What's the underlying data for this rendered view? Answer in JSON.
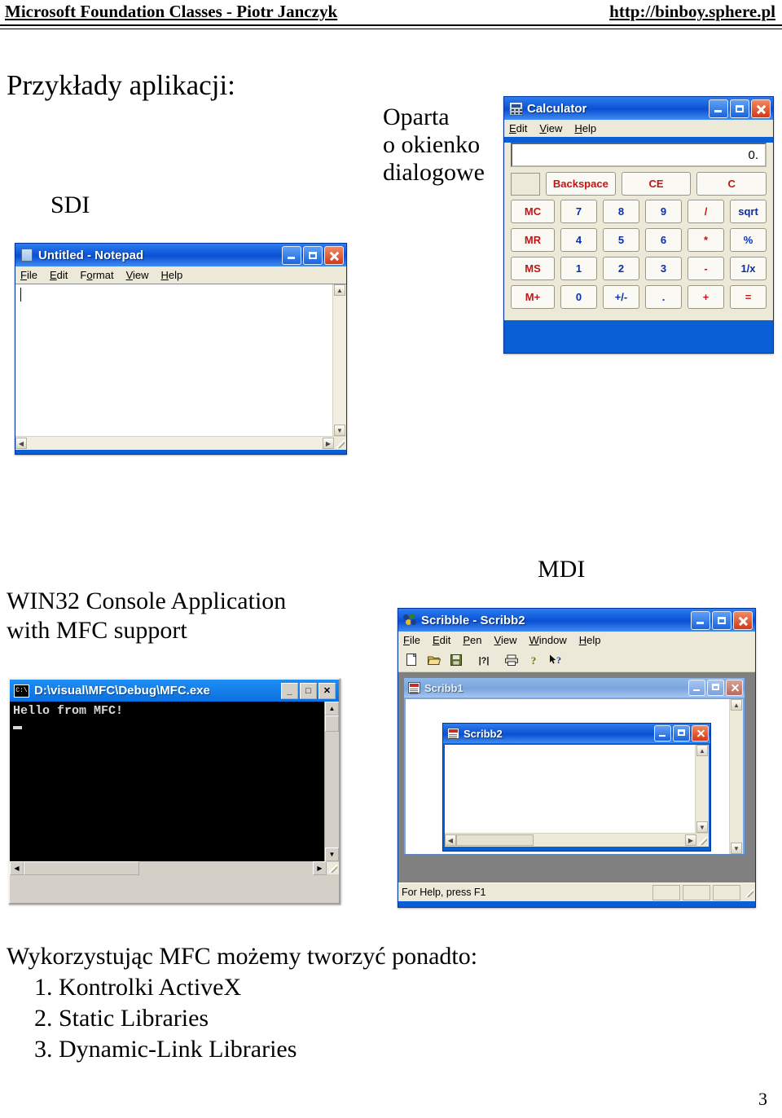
{
  "header": {
    "left": "Microsoft Foundation Classes - Piotr Janczyk",
    "right": "http://binboy.sphere.pl"
  },
  "slide": {
    "title": "Przykłady aplikacji:",
    "label_sdi": "SDI",
    "label_mdi": "MDI",
    "label_dialog_line1": "Oparta",
    "label_dialog_line2": "o okienko",
    "label_dialog_line3": "dialogowe",
    "label_console_line1": "WIN32 Console Application",
    "label_console_line2": "with MFC support",
    "footer_intro": "Wykorzystując MFC możemy tworzyć ponadto:",
    "footer_items": [
      "1. Kontrolki ActiveX",
      "2. Static Libraries",
      "3. Dynamic-Link Libraries"
    ],
    "page_number": "3"
  },
  "notepad": {
    "title": "Untitled - Notepad",
    "icon": "notepad-icon",
    "menu": [
      {
        "accel": "F",
        "rest": "ile"
      },
      {
        "accel": "E",
        "rest": "dit"
      },
      {
        "pre": "F",
        "accel": "o",
        "rest": "rmat"
      },
      {
        "accel": "V",
        "rest": "iew"
      },
      {
        "accel": "H",
        "rest": "elp"
      }
    ],
    "text": "",
    "buttons": {
      "minimize": "minimize",
      "maximize": "maximize",
      "close": "close"
    }
  },
  "calculator": {
    "title": "Calculator",
    "icon": "calculator-icon",
    "menu": [
      {
        "accel": "E",
        "rest": "dit"
      },
      {
        "accel": "V",
        "rest": "iew"
      },
      {
        "accel": "H",
        "rest": "elp"
      }
    ],
    "display": "0.",
    "memory_indicator": "",
    "top_row": [
      "Backspace",
      "CE",
      "C"
    ],
    "rows": [
      {
        "mem": "MC",
        "keys": [
          "7",
          "8",
          "9",
          "/",
          "sqrt"
        ]
      },
      {
        "mem": "MR",
        "keys": [
          "4",
          "5",
          "6",
          "*",
          "%"
        ]
      },
      {
        "mem": "MS",
        "keys": [
          "1",
          "2",
          "3",
          "-",
          "1/x"
        ]
      },
      {
        "mem": "M+",
        "keys": [
          "0",
          "+/-",
          ".",
          "+",
          "="
        ]
      }
    ],
    "colors": {
      "digit": "#0a2fa8",
      "operator": "#c01515",
      "memory": "#c01515"
    }
  },
  "console": {
    "title": "D:\\visual\\MFC\\Debug\\MFC.exe",
    "icon": "console-icon",
    "output": "Hello from MFC!",
    "buttons": {
      "minimize": "_",
      "maximize": "□",
      "close": "✕"
    }
  },
  "scribble": {
    "title": "Scribble - Scribb2",
    "icon": "scribble-app-icon",
    "menu": [
      {
        "accel": "F",
        "rest": "ile"
      },
      {
        "accel": "E",
        "rest": "dit"
      },
      {
        "accel": "P",
        "rest": "en"
      },
      {
        "accel": "V",
        "rest": "iew"
      },
      {
        "accel": "W",
        "rest": "indow"
      },
      {
        "accel": "H",
        "rest": "elp"
      }
    ],
    "toolbar": [
      {
        "name": "new-icon",
        "glyph": "🗋"
      },
      {
        "name": "open-icon",
        "glyph": "📂"
      },
      {
        "name": "save-icon",
        "glyph": "💾"
      },
      {
        "name": "properties-icon",
        "glyph": "|?|"
      },
      {
        "name": "print-icon",
        "glyph": "🖨"
      },
      {
        "name": "about-icon",
        "glyph": "?"
      },
      {
        "name": "context-help-icon",
        "glyph": "↖?"
      }
    ],
    "children": [
      {
        "title": "Scribb1",
        "state": "inactive"
      },
      {
        "title": "Scribb2",
        "state": "active"
      }
    ],
    "statusbar": "For Help, press F1"
  }
}
